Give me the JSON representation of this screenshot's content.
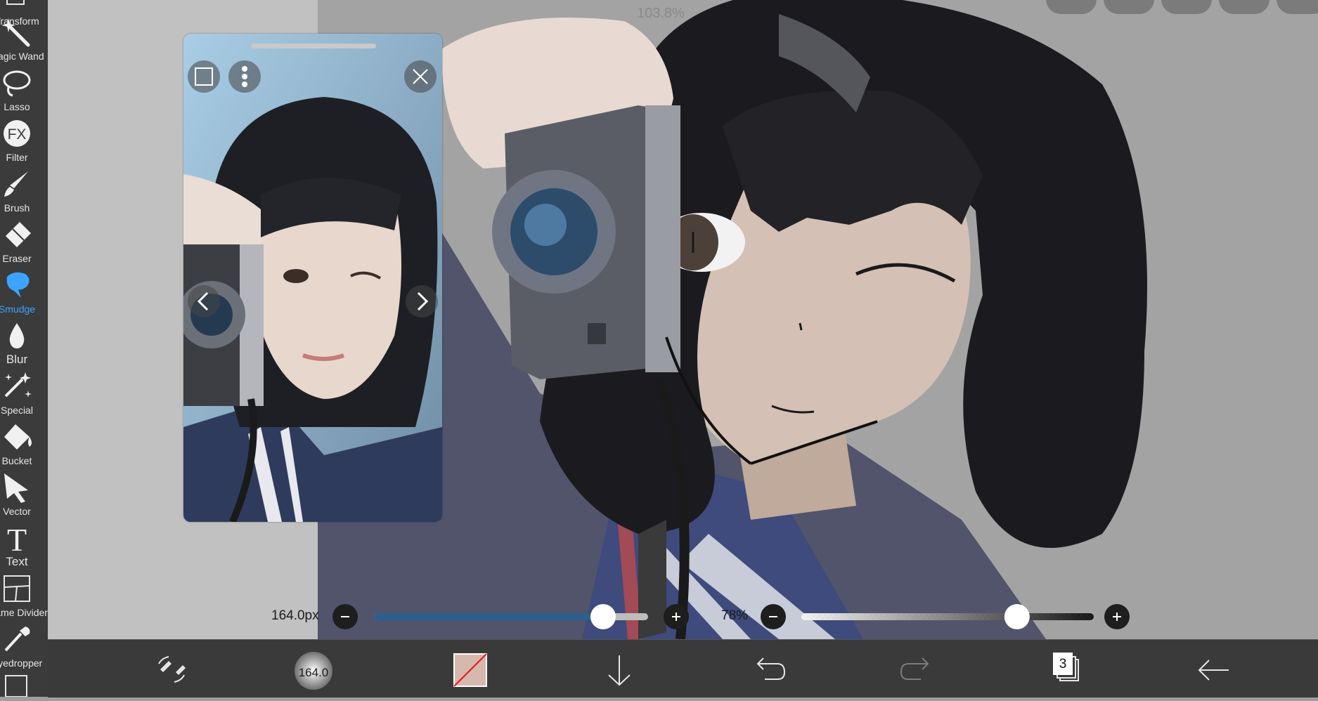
{
  "toolbar": {
    "tools": [
      {
        "label": "Transform",
        "icon": "transform-icon"
      },
      {
        "label": "Magic Wand",
        "icon": "magic-wand-icon"
      },
      {
        "label": "Lasso",
        "icon": "lasso-icon"
      },
      {
        "label": "Filter",
        "icon": "fx-icon",
        "glyph": "FX"
      },
      {
        "label": "Brush",
        "icon": "brush-icon"
      },
      {
        "label": "Eraser",
        "icon": "eraser-icon"
      },
      {
        "label": "Smudge",
        "icon": "smudge-icon",
        "active": true
      },
      {
        "label": "Blur",
        "icon": "blur-drop-icon"
      },
      {
        "label": "Special",
        "icon": "special-icon"
      },
      {
        "label": "Bucket",
        "icon": "bucket-icon"
      },
      {
        "label": "Vector",
        "icon": "vector-arrow-icon"
      },
      {
        "label": "Text",
        "icon": "text-icon",
        "glyph": "T"
      },
      {
        "label": "Frame Divider",
        "icon": "frame-divider-icon"
      },
      {
        "label": "Eyedropper",
        "icon": "eyedropper-icon"
      }
    ]
  },
  "canvas": {
    "zoom_readout": "103.8%"
  },
  "brush_size_slider": {
    "value_label": "164.0px",
    "fraction": 0.87,
    "track_color": "#2c5f8f"
  },
  "opacity_slider": {
    "value_label": "78%",
    "fraction": 0.76
  },
  "bottom_bar": {
    "brush_preview_value": "164.0",
    "layer_count": "3"
  },
  "colors": {
    "accent": "#3da3ff",
    "toolbar_bg": "#3b3b3b",
    "bottom_bar_bg": "#3a3a3a",
    "color_swatch": "#d7b8ad"
  }
}
